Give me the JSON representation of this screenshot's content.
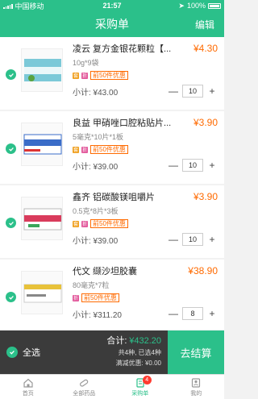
{
  "status": {
    "carrier": "中国移动",
    "time": "21:57",
    "battery": "100%"
  },
  "nav": {
    "title": "采购单",
    "edit": "编辑"
  },
  "items": [
    {
      "name": "凌云 复方金银花颗粒【...",
      "spec": "10g*9袋",
      "price": "¥4.30",
      "subtotal": "小计: ¥43.00",
      "qty": "10",
      "promo": "前50件优惠",
      "tag1": "套",
      "tag2": "折",
      "thumb_color": "#7cc9d8",
      "thumb_label": "复方金银花颗粒"
    },
    {
      "name": "良益 甲硝唑口腔粘贴片...",
      "spec": "5毫克*10片*1板",
      "price": "¥3.90",
      "subtotal": "小计: ¥39.00",
      "qty": "10",
      "promo": "前50件优惠",
      "tag1": "套",
      "tag2": "折",
      "thumb_color": "#3a6cc8",
      "thumb_label": "甲硝唑口腔粘贴片"
    },
    {
      "name": "鑫齐 铝碳酸镁咀嚼片",
      "spec": "0.5克*8片*3板",
      "price": "¥3.90",
      "subtotal": "小计: ¥39.00",
      "qty": "10",
      "promo": "前50件优惠",
      "tag1": "套",
      "tag2": "折",
      "thumb_color": "#d93b5c",
      "thumb_label": "铝碳酸镁咀嚼片"
    },
    {
      "name": "代文 缬沙坦胶囊",
      "spec": "80毫克*7粒",
      "price": "¥38.90",
      "subtotal": "小计: ¥311.20",
      "qty": "8",
      "promo": "前50件优惠",
      "tag1": "折",
      "tag2": "",
      "thumb_color": "#e8c23a",
      "thumb_label": "缬沙坦胶囊"
    }
  ],
  "footer": {
    "select_all": "全选",
    "total_label": "合计:",
    "total": "¥432.20",
    "count_text": "共4种, 已选4种",
    "discount_text": "满减优惠: ¥0.00",
    "checkout": "去结算"
  },
  "tabs": [
    {
      "label": "首页",
      "icon": "home-icon"
    },
    {
      "label": "全部药品",
      "icon": "pill-icon"
    },
    {
      "label": "采购单",
      "icon": "cart-icon",
      "badge": "4"
    },
    {
      "label": "我的",
      "icon": "user-icon"
    }
  ],
  "colors": {
    "accent": "#2bc08a",
    "price": "#ff6a00",
    "dark": "#3b3b3b"
  }
}
